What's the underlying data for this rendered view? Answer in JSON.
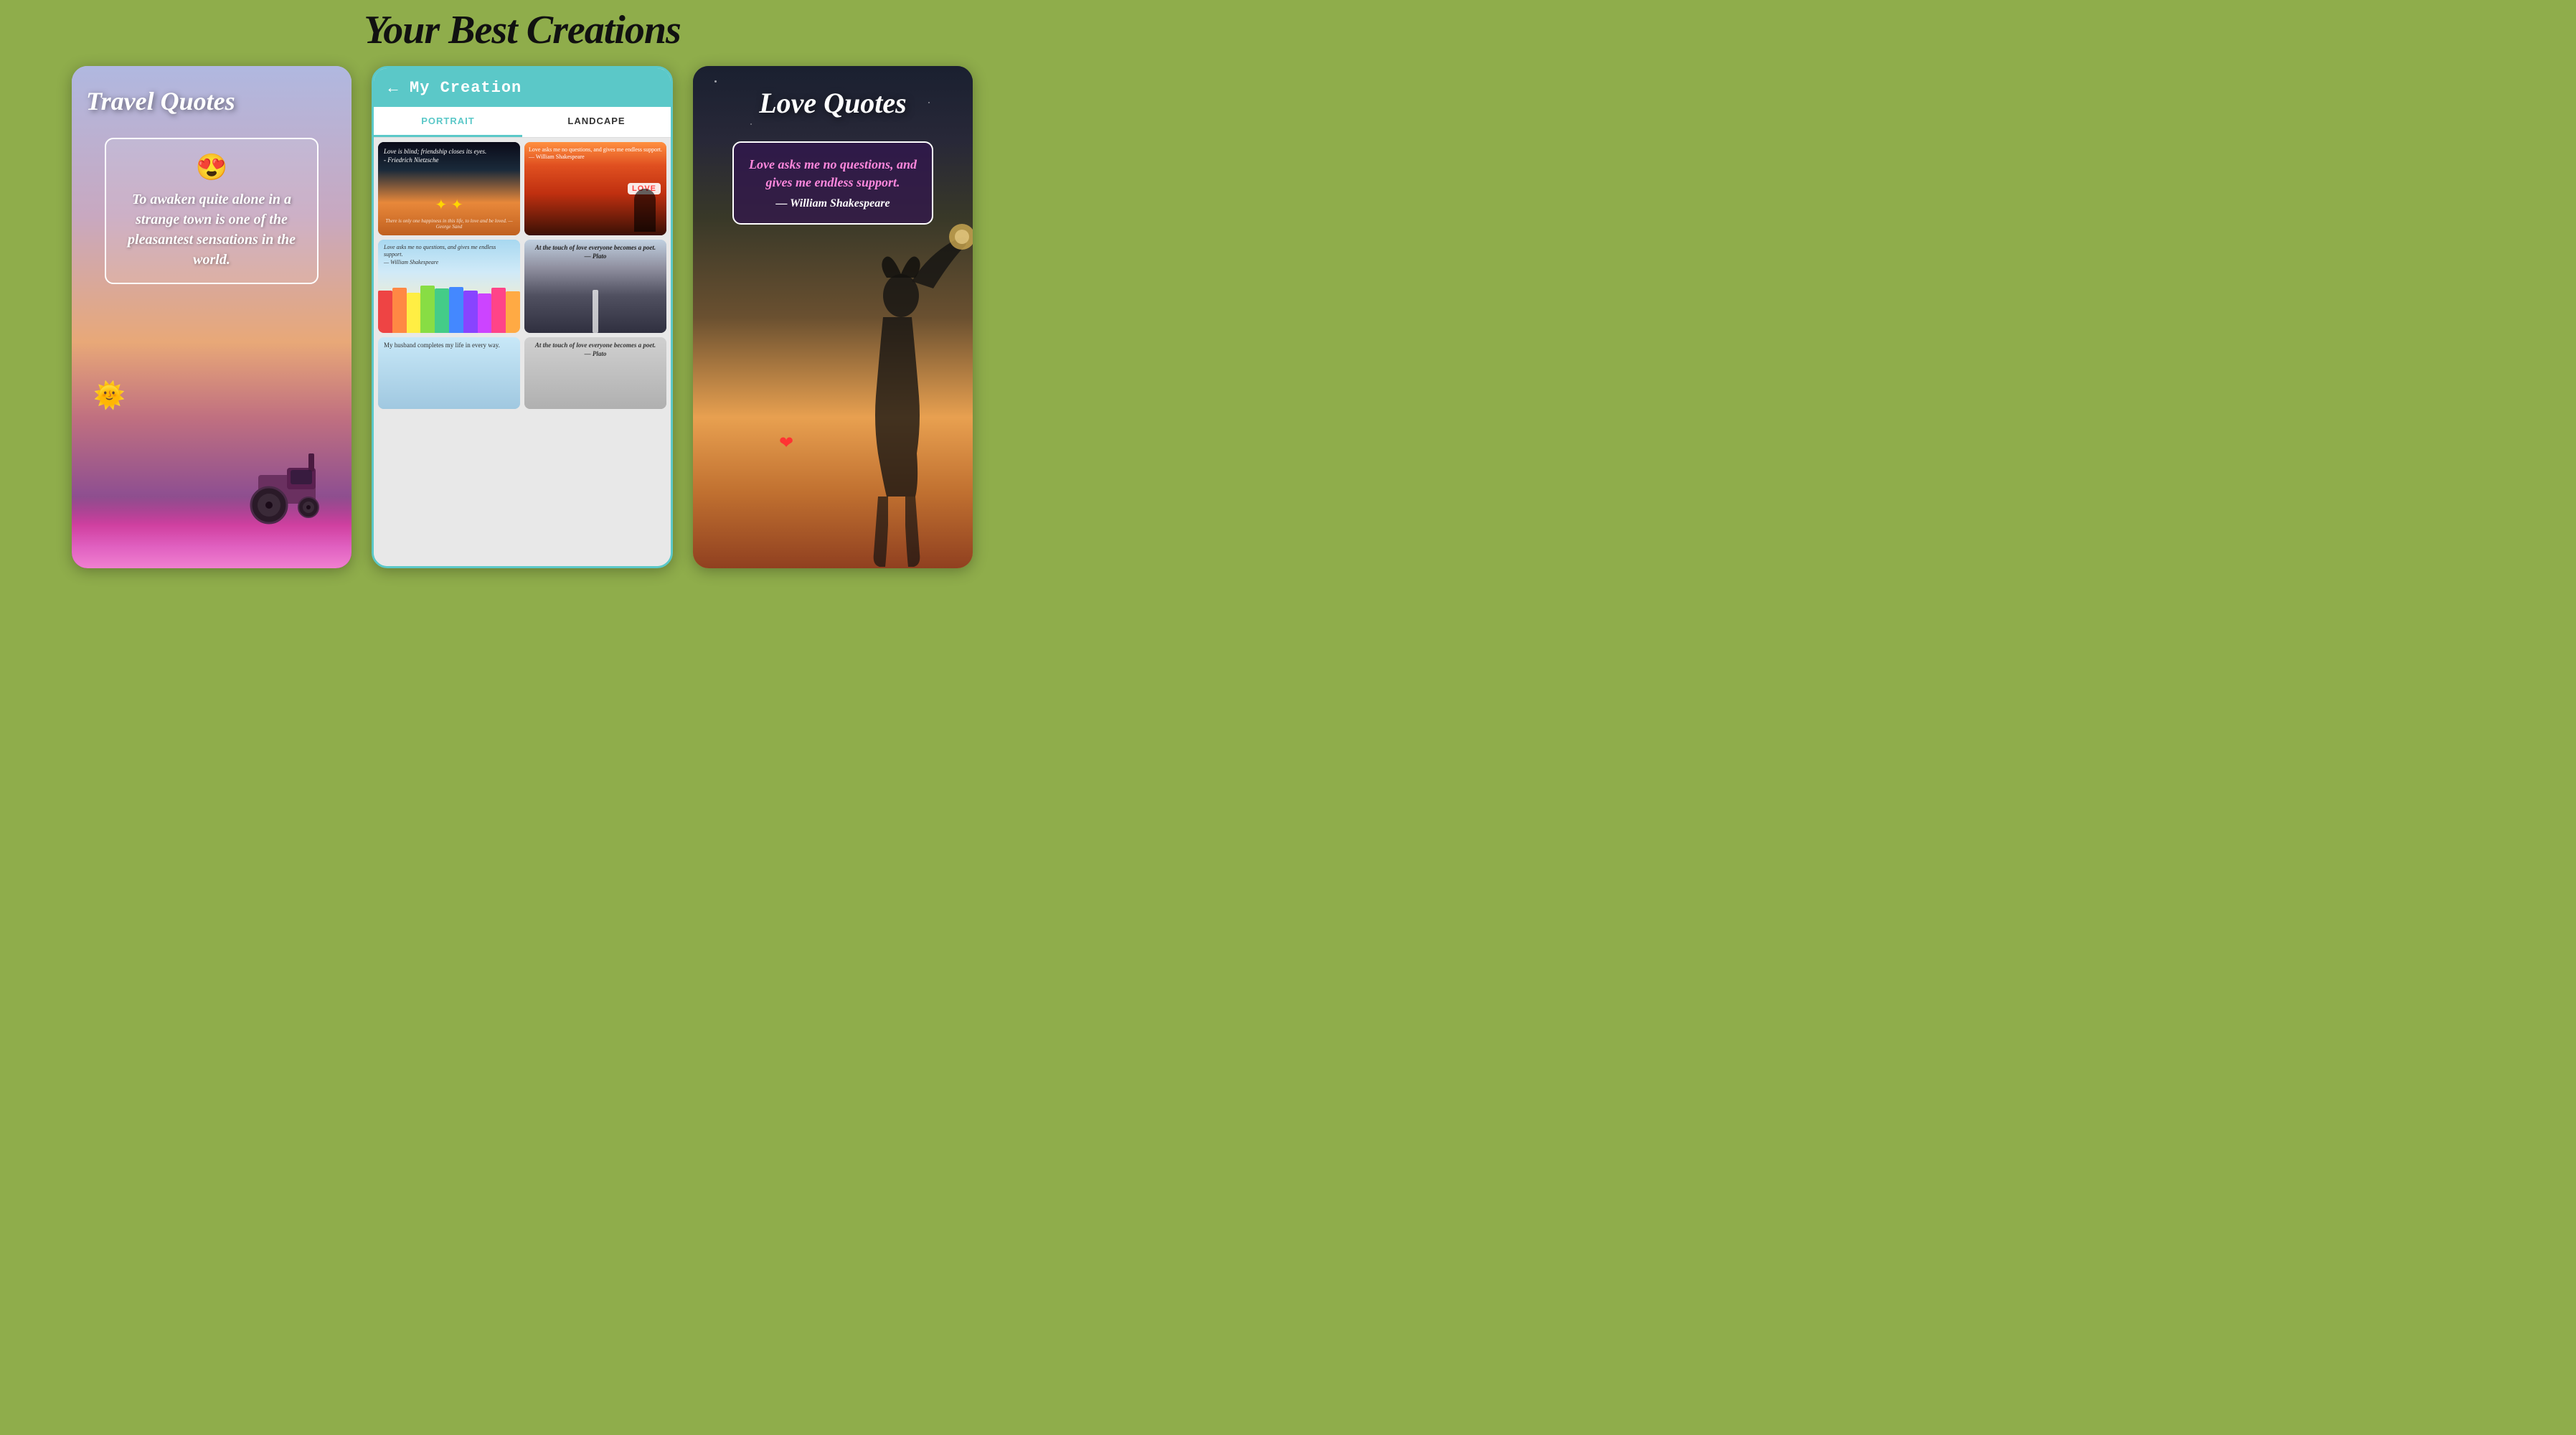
{
  "page": {
    "background_color": "#8fad4b",
    "title": "Your Best Creations"
  },
  "left_card": {
    "title": "Travel Quotes",
    "emoji_face": "😍",
    "sun_emoji": "🌞",
    "quote": "To awaken quite alone in a strange town is one of the pleasantest sensations in the world."
  },
  "middle_card": {
    "header_title": "My Creation",
    "back_label": "←",
    "tabs": [
      {
        "label": "PORTRAIT",
        "active": true
      },
      {
        "label": "LANDCAPE",
        "active": false
      }
    ],
    "grid": {
      "row1": [
        {
          "text": "Love is blind; friendship closes its eyes.\n- Friedrich Nietzsche",
          "sparkle": "✦"
        },
        {
          "text": "Love asks me no questions, and gives me endless support.\n— William Shakespeare",
          "badge": "LOVE"
        }
      ],
      "row2": [
        {
          "text": "Love asks me no questions, and gives me endless support.\n— William Shakespeare"
        },
        {
          "text": "At the touch of love everyone becomes a poet.\n— Plato"
        }
      ],
      "row3": [
        {
          "text": "My husband completes my life in every way."
        },
        {
          "text": "At the touch of love everyone becomes a poet.\n— Plato"
        }
      ]
    },
    "quote_bottom": "There is only one happiness in this life, to love and be loved.\n— George Sand"
  },
  "right_card": {
    "title": "Love Quotes",
    "quote_text": "Love asks me no questions, and gives me endless support.",
    "quote_author": "— William Shakespeare"
  },
  "pencil_colors": [
    "#e44",
    "#f84",
    "#fe4",
    "#8d4",
    "#4c8",
    "#48f",
    "#84f",
    "#c4f",
    "#f48",
    "#fa4"
  ]
}
